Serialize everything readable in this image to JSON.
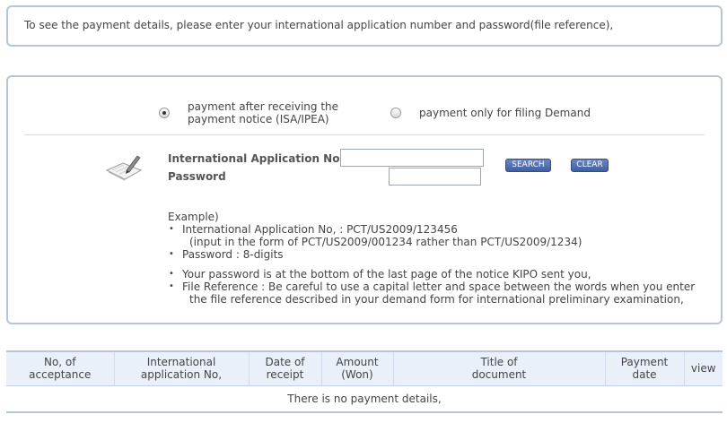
{
  "notice": {
    "text": "To see the payment details, please enter your international application number and password(file reference),"
  },
  "payment_type": {
    "options": [
      {
        "label": "payment after receiving the payment notice (ISA/IPEA)",
        "selected": true
      },
      {
        "label": "payment only for filing Demand",
        "selected": false
      }
    ]
  },
  "form": {
    "app_no_label": "International Application No,",
    "app_no_value": "",
    "password_label": "Password",
    "password_value": "",
    "search_label": "SEARCH",
    "clear_label": "CLEAR"
  },
  "example": {
    "title": "Example)",
    "item1": "International Application No, : PCT/US2009/123456",
    "item1_sub": "(input in the form of PCT/US2009/001234 rather than PCT/US2009/1234)",
    "item2": "Password : 8-digits",
    "item3": "Your password is at the bottom of the last page of the notice KIPO sent you,",
    "item4": "File Reference : Be careful to use a capital letter and space between the words when you enter",
    "item4_sub": "the file reference described in your demand form for international preliminary examination,"
  },
  "table": {
    "headers": [
      {
        "line1": "No, of",
        "line2": "acceptance"
      },
      {
        "line1": "International",
        "line2": "application No,"
      },
      {
        "line1": "Date of",
        "line2": "receipt"
      },
      {
        "line1": "Amount",
        "line2": "(Won)"
      },
      {
        "line1": "Title of",
        "line2": "document"
      },
      {
        "line1": "Payment",
        "line2": "date"
      },
      {
        "line1": "view",
        "line2": ""
      }
    ],
    "empty_message": "There is no payment details,"
  },
  "colors": {
    "border": "#b7c5dc",
    "header_bg": "#eaf0fa",
    "button": "#3f5f9f"
  }
}
